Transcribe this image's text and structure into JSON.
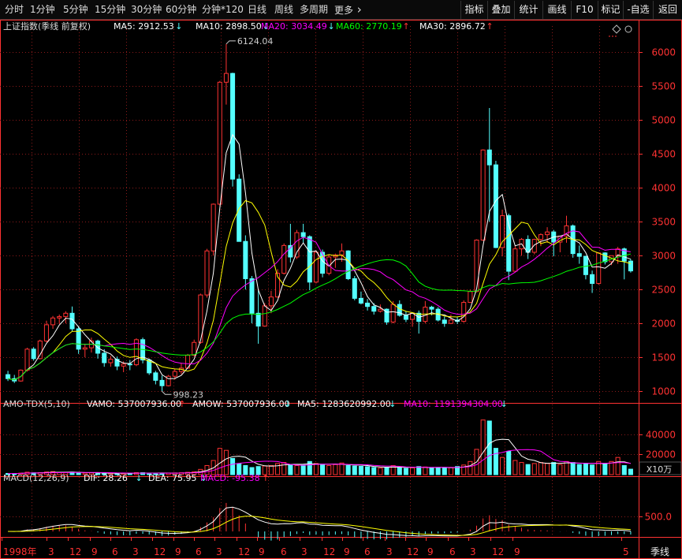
{
  "toolbar": {
    "periods": [
      "分时",
      "1分钟",
      "5分钟",
      "15分钟",
      "30分钟",
      "60分钟",
      "分钟*120",
      "日线",
      "周线",
      "多周期"
    ],
    "more_label": "更多",
    "more_icon": "chevron-right-icon",
    "right_buttons": [
      "指标",
      "叠加",
      "统计",
      "画线",
      "F10",
      "标记",
      "-自选",
      "返回"
    ]
  },
  "colors": {
    "up": "#ff3232",
    "down": "#54ffff",
    "ma5": "#ffffff",
    "ma10": "#ffff00",
    "ma20": "#ff00ff",
    "ma60": "#00ff00",
    "ma30": "#ffffff",
    "grid": "#8b1a1a",
    "axis": "#ff3232"
  },
  "price_panel": {
    "title": "上证指数(季线 前复权)",
    "legend": [
      {
        "text": "MA5: 2912.53",
        "color": "#ffffff",
        "arrow": "↓",
        "arrow_color": "#54ffff"
      },
      {
        "text": "MA10: 2898.50",
        "color": "#ffffff",
        "arrow": "↓",
        "arrow_color": "#54ffff"
      },
      {
        "text": "MA20: 3034.49",
        "color": "#ff00ff",
        "arrow": "↓",
        "arrow_color": "#54ffff"
      },
      {
        "text": "MA60: 2770.19",
        "color": "#00ff00",
        "arrow": "↑",
        "arrow_color": "#ff3232"
      },
      {
        "text": "MA30: 2896.72",
        "color": "#ffffff",
        "arrow": "↑",
        "arrow_color": "#ff3232"
      }
    ],
    "y_ticks": [
      "6000",
      "5500",
      "5000",
      "4500",
      "4000",
      "3500",
      "3000",
      "2500",
      "2000",
      "1500",
      "1000"
    ],
    "annotations": {
      "high": "6124.04",
      "low": "998.23"
    }
  },
  "volume_panel": {
    "title": "AMO-TDX(5,10)",
    "legend": [
      {
        "text": "VAMO: 537007936.00",
        "color": "#ffffff",
        "arrow": "↑",
        "arrow_color": "#ff3232"
      },
      {
        "text": "AMOW: 537007936.00",
        "color": "#ffffff",
        "arrow": "↓",
        "arrow_color": "#54ffff"
      },
      {
        "text": "MA5: 1283620992.00",
        "color": "#ffffff",
        "arrow": "↓",
        "arrow_color": "#54ffff"
      },
      {
        "text": "MA10: 1191394304.00",
        "color": "#ff00ff",
        "arrow": "↓",
        "arrow_color": "#54ffff"
      }
    ],
    "y_ticks": [
      "40000",
      "20000"
    ],
    "unit": "X10万"
  },
  "macd_panel": {
    "title": "MACD(12,26,9)",
    "legend": [
      {
        "text": "DIF: 28.26",
        "color": "#ffffff",
        "arrow": "↓",
        "arrow_color": "#54ffff"
      },
      {
        "text": "DEA: 75.95",
        "color": "#ffffff",
        "arrow": "↓",
        "arrow_color": "#54ffff"
      },
      {
        "text": "MACD: -95.38",
        "color": "#ff00ff",
        "arrow": "↑",
        "arrow_color": "#ff3232"
      }
    ],
    "y_ticks": [
      "500.0"
    ]
  },
  "x_axis": {
    "labels": [
      "1998年",
      "3",
      "12",
      "9",
      "6",
      "3",
      "12",
      "9",
      "6",
      "3",
      "12",
      "9",
      "6",
      "3",
      "12",
      "9",
      "6",
      "3",
      "12",
      "9",
      "6",
      "3",
      "12",
      "9",
      "5"
    ]
  },
  "period_label": "季线",
  "chart_data": {
    "type": "candlestick",
    "title": "上证指数(季线 前复权)",
    "series": [
      {
        "name": "MA5",
        "value": 2912.53
      },
      {
        "name": "MA10",
        "value": 2898.5
      },
      {
        "name": "MA20",
        "value": 3034.49
      },
      {
        "name": "MA60",
        "value": 2770.19
      },
      {
        "name": "MA30",
        "value": 2896.72
      }
    ],
    "ohlc": [
      [
        1244,
        1300,
        1150,
        1185
      ],
      [
        1185,
        1240,
        1120,
        1150
      ],
      [
        1150,
        1320,
        1140,
        1310
      ],
      [
        1310,
        1640,
        1290,
        1620
      ],
      [
        1620,
        1650,
        1450,
        1480
      ],
      [
        1480,
        1760,
        1470,
        1740
      ],
      [
        1740,
        2040,
        1720,
        1980
      ],
      [
        1980,
        2110,
        1920,
        2080
      ],
      [
        2080,
        2130,
        1990,
        2100
      ],
      [
        2100,
        2180,
        2000,
        2150
      ],
      [
        2150,
        2250,
        1880,
        1920
      ],
      [
        1920,
        1960,
        1550,
        1620
      ],
      [
        1620,
        1700,
        1500,
        1640
      ],
      [
        1640,
        1790,
        1570,
        1740
      ],
      [
        1740,
        1760,
        1480,
        1560
      ],
      [
        1560,
        1620,
        1360,
        1420
      ],
      [
        1420,
        1520,
        1360,
        1470
      ],
      [
        1470,
        1510,
        1310,
        1370
      ],
      [
        1370,
        1440,
        1280,
        1400
      ],
      [
        1400,
        1460,
        1310,
        1390
      ],
      [
        1390,
        1780,
        1370,
        1760
      ],
      [
        1760,
        1790,
        1410,
        1460
      ],
      [
        1460,
        1480,
        1240,
        1270
      ],
      [
        1270,
        1300,
        1100,
        1160
      ],
      [
        1160,
        1230,
        998,
        1080
      ],
      [
        1080,
        1240,
        1070,
        1220
      ],
      [
        1220,
        1330,
        1170,
        1290
      ],
      [
        1290,
        1420,
        1250,
        1340
      ],
      [
        1340,
        1550,
        1330,
        1530
      ],
      [
        1530,
        1760,
        1510,
        1720
      ],
      [
        1720,
        2440,
        1700,
        2420
      ],
      [
        2420,
        3100,
        2380,
        3070
      ],
      [
        3070,
        3770,
        3000,
        3760
      ],
      [
        3760,
        5580,
        3740,
        5560
      ],
      [
        5560,
        6124,
        5230,
        5690
      ],
      [
        5690,
        5700,
        4020,
        4130
      ],
      [
        4130,
        4200,
        3230,
        3210
      ],
      [
        3210,
        3300,
        2500,
        2660
      ],
      [
        2660,
        2700,
        2000,
        2150
      ],
      [
        2150,
        2500,
        1700,
        1960
      ],
      [
        1960,
        2300,
        1950,
        2260
      ],
      [
        2260,
        2480,
        2150,
        2390
      ],
      [
        2390,
        2800,
        2380,
        2740
      ],
      [
        2740,
        3180,
        2720,
        3150
      ],
      [
        3150,
        3470,
        2900,
        2980
      ],
      [
        2980,
        3380,
        2950,
        3340
      ],
      [
        3340,
        3470,
        3180,
        3280
      ],
      [
        3280,
        3300,
        2490,
        2610
      ],
      [
        2610,
        3070,
        2590,
        3050
      ],
      [
        3050,
        3090,
        2680,
        2740
      ],
      [
        2740,
        3010,
        2710,
        2980
      ],
      [
        2980,
        3030,
        2820,
        3010
      ],
      [
        3010,
        3180,
        2910,
        3070
      ],
      [
        3070,
        3080,
        2640,
        2660
      ],
      [
        2660,
        2700,
        2340,
        2370
      ],
      [
        2370,
        2470,
        2280,
        2300
      ],
      [
        2300,
        2360,
        2190,
        2250
      ],
      [
        2250,
        2300,
        2130,
        2180
      ],
      [
        2180,
        2280,
        2160,
        2210
      ],
      [
        2210,
        2220,
        1980,
        2020
      ],
      [
        2020,
        2330,
        2000,
        2280
      ],
      [
        2280,
        2340,
        2100,
        2120
      ],
      [
        2120,
        2180,
        2020,
        2060
      ],
      [
        2060,
        2160,
        1950,
        2150
      ],
      [
        2150,
        2190,
        1850,
        2030
      ],
      [
        2030,
        2330,
        2000,
        2240
      ],
      [
        2240,
        2260,
        2120,
        2210
      ],
      [
        2210,
        2240,
        2030,
        2050
      ],
      [
        2050,
        2100,
        1950,
        2000
      ],
      [
        2000,
        2130,
        1990,
        2050
      ],
      [
        2050,
        2090,
        1990,
        2030
      ],
      [
        2030,
        2340,
        2010,
        2310
      ],
      [
        2310,
        2500,
        2300,
        2470
      ],
      [
        2470,
        3240,
        2460,
        3230
      ],
      [
        3230,
        4570,
        3220,
        4560
      ],
      [
        4560,
        5180,
        3500,
        4340
      ],
      [
        4340,
        4400,
        3110,
        3120
      ],
      [
        3120,
        3680,
        2990,
        3590
      ],
      [
        3590,
        3620,
        2640,
        2770
      ],
      [
        2770,
        3150,
        2760,
        3100
      ],
      [
        3100,
        3260,
        3000,
        3240
      ],
      [
        3240,
        3300,
        2950,
        3050
      ],
      [
        3050,
        3250,
        3020,
        3240
      ],
      [
        3240,
        3330,
        3140,
        3310
      ],
      [
        3310,
        3420,
        3190,
        3350
      ],
      [
        3350,
        3380,
        2990,
        3200
      ],
      [
        3200,
        3290,
        3050,
        3290
      ],
      [
        3290,
        3590,
        3190,
        3440
      ],
      [
        3440,
        3460,
        2970,
        3030
      ],
      [
        3030,
        3150,
        2880,
        2990
      ],
      [
        2990,
        3000,
        2650,
        2720
      ],
      [
        2720,
        2780,
        2450,
        2590
      ],
      [
        2590,
        3050,
        2570,
        3040
      ],
      [
        3040,
        3050,
        2870,
        2910
      ],
      [
        2910,
        3000,
        2860,
        3000
      ],
      [
        3000,
        3130,
        2880,
        3100
      ],
      [
        3100,
        3120,
        2650,
        2920
      ],
      [
        2920,
        2950,
        2750,
        2775
      ]
    ],
    "volume": [
      120,
      110,
      150,
      240,
      180,
      200,
      260,
      300,
      210,
      230,
      250,
      180,
      150,
      170,
      160,
      140,
      130,
      120,
      130,
      125,
      200,
      190,
      150,
      130,
      140,
      160,
      170,
      190,
      230,
      280,
      520,
      900,
      1400,
      2600,
      2400,
      1600,
      1100,
      900,
      700,
      800,
      850,
      900,
      1100,
      1200,
      1000,
      900,
      950,
      1300,
      1100,
      950,
      900,
      1000,
      1150,
      900,
      850,
      820,
      780,
      700,
      650,
      720,
      900,
      700,
      620,
      680,
      800,
      760,
      650,
      700,
      680,
      690,
      800,
      950,
      1300,
      2500,
      5400,
      5300,
      2600,
      1700,
      2300,
      1400,
      1200,
      1000,
      1100,
      1200,
      1100,
      1200,
      1000,
      1300,
      1200,
      1000,
      1100,
      950,
      1300,
      1100,
      1300,
      1700,
      900,
      540
    ],
    "macd": {
      "dif": 28.26,
      "dea": 75.95,
      "macd": -95.38
    },
    "ylim": [
      850,
      6250
    ],
    "y_ticks": [
      1000,
      1500,
      2000,
      2500,
      3000,
      3500,
      4000,
      4500,
      5000,
      5500,
      6000
    ],
    "x_labels": [
      "1998年",
      "3",
      "12",
      "9",
      "6",
      "3",
      "12",
      "9",
      "6",
      "3",
      "12",
      "9",
      "6",
      "3",
      "12",
      "9",
      "6",
      "3",
      "12",
      "9",
      "6",
      "3",
      "12",
      "9",
      "5"
    ],
    "annotations": [
      {
        "text": "6124.04",
        "value": 6124.04
      },
      {
        "text": "998.23",
        "value": 998.23
      }
    ]
  }
}
